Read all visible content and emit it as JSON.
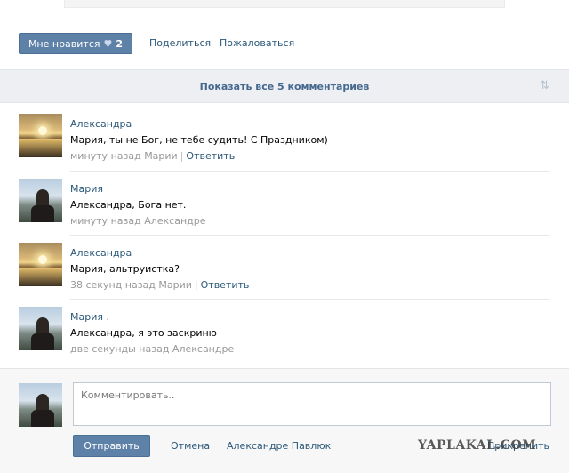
{
  "post_actions": {
    "like_label": "Мне нравится",
    "like_count": "2",
    "share_label": "Поделиться",
    "report_label": "Пожаловаться"
  },
  "show_all": {
    "label": "Показать все 5 комментариев",
    "sort_icon": "sort-arrows-icon"
  },
  "comments": [
    {
      "author": "Александра",
      "text": "Мария, ты не Бог, не тебе судить! С Праздником)",
      "time": "минуту назад Марии",
      "reply": "Ответить",
      "avatar": "sunset"
    },
    {
      "author": "Мария",
      "text": "Александра, Бога нет.",
      "time": "минуту назад Александре",
      "reply": "",
      "avatar": "girl"
    },
    {
      "author": "Александра",
      "text": "Мария, альтруистка?",
      "time": "38 секунд назад Марии",
      "reply": "Ответить",
      "avatar": "sunset"
    },
    {
      "author": "Мария .",
      "text": "Александра, я это заскриню",
      "time": "две секунды назад Александре",
      "reply": "",
      "avatar": "girl"
    }
  ],
  "compose": {
    "placeholder": "Комментировать..",
    "send_label": "Отправить",
    "cancel_label": "Отмена",
    "reply_to": "Александре Павлюк",
    "attach_label": "Прикрепить",
    "watermark": "YAPLAKAL.COM"
  },
  "colors": {
    "accent": "#5e81a8",
    "link": "#2b587a",
    "bar": "#edeff3"
  }
}
